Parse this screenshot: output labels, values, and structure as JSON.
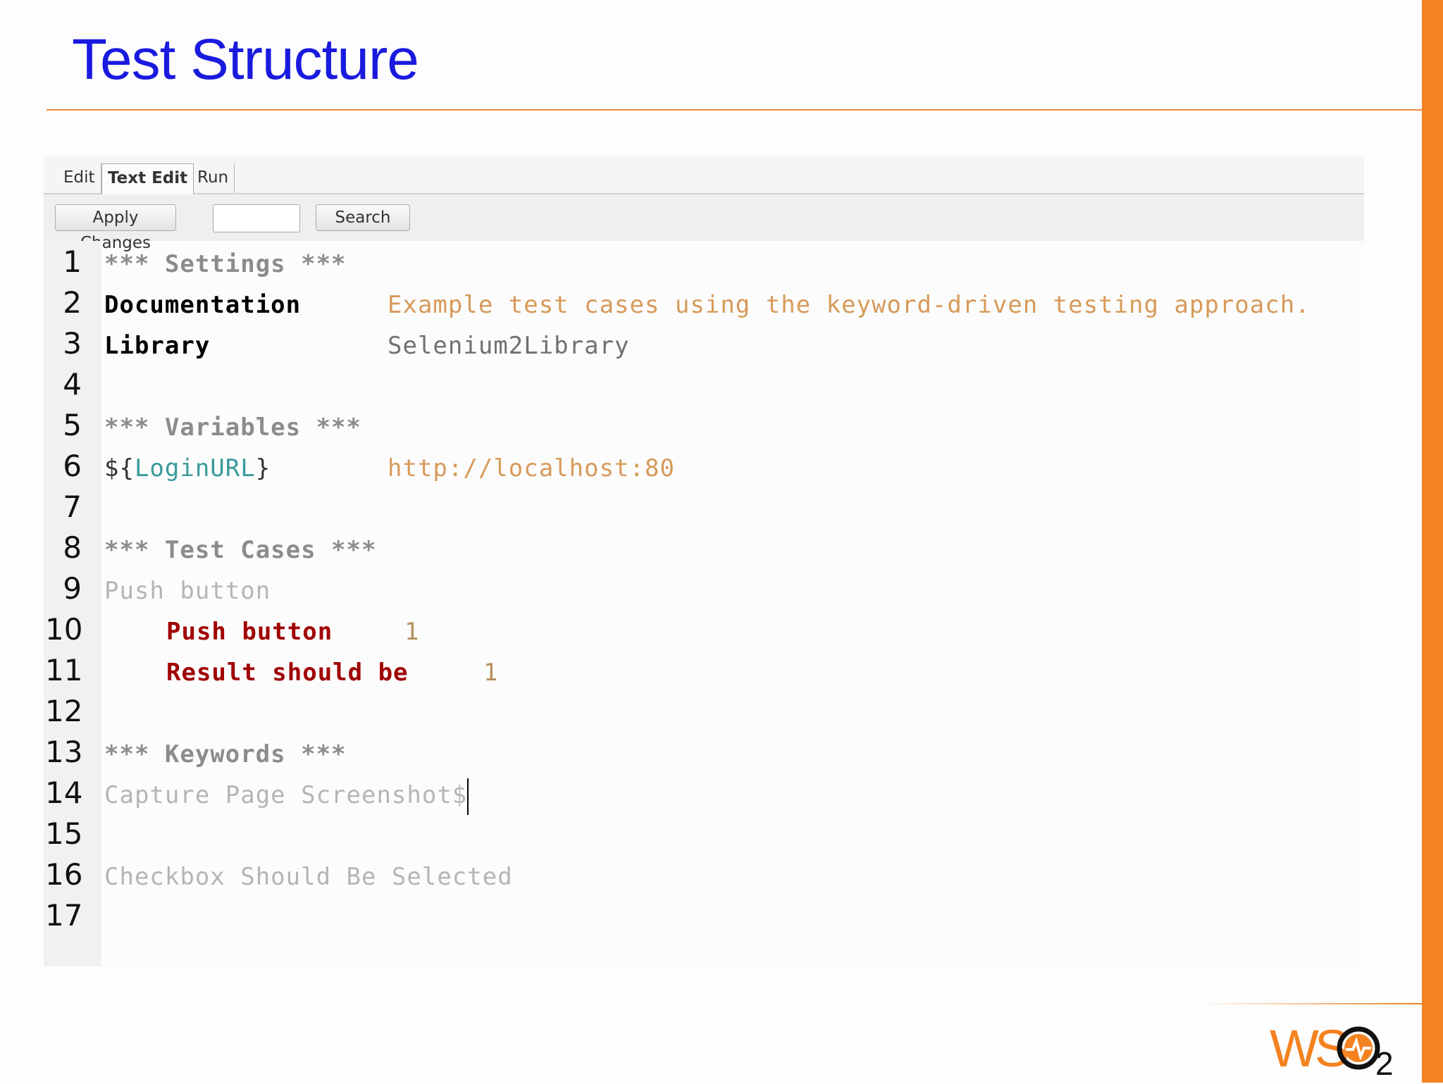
{
  "slide": {
    "title": "Test Structure"
  },
  "tabs": [
    {
      "label": "Edit"
    },
    {
      "label": "Text Edit",
      "active": true
    },
    {
      "label": "Run"
    }
  ],
  "toolbar": {
    "apply_label": "Apply Changes",
    "search_value": "",
    "search_label": "Search"
  },
  "editor": {
    "line_numbers": [
      "1",
      "2",
      "3",
      "4",
      "5",
      "6",
      "7",
      "8",
      "9",
      "10",
      "11",
      "12",
      "13",
      "14",
      "15",
      "16",
      "17"
    ],
    "lines": {
      "l1": "*** Settings ***",
      "l2_key": "Documentation",
      "l2_val": "Example test cases using the keyword-driven testing approach.",
      "l3_key": "Library",
      "l3_val": "Selenium2Library",
      "l5": "*** Variables ***",
      "l6_open": "${",
      "l6_name": "LoginURL",
      "l6_close": "}",
      "l6_val": "http://localhost:80",
      "l8": "*** Test Cases ***",
      "l9": "Push button",
      "l10_kw": "Push button",
      "l10_arg": "1",
      "l11_kw": "Result should be",
      "l11_arg": "1",
      "l13": "*** Keywords ***",
      "l14": "Capture Page Screenshot$",
      "l16": "Checkbox Should Be Selected"
    }
  },
  "logo": {
    "text": "WSO2"
  },
  "colors": {
    "accent": "#f58220",
    "title": "#1a1adf"
  }
}
